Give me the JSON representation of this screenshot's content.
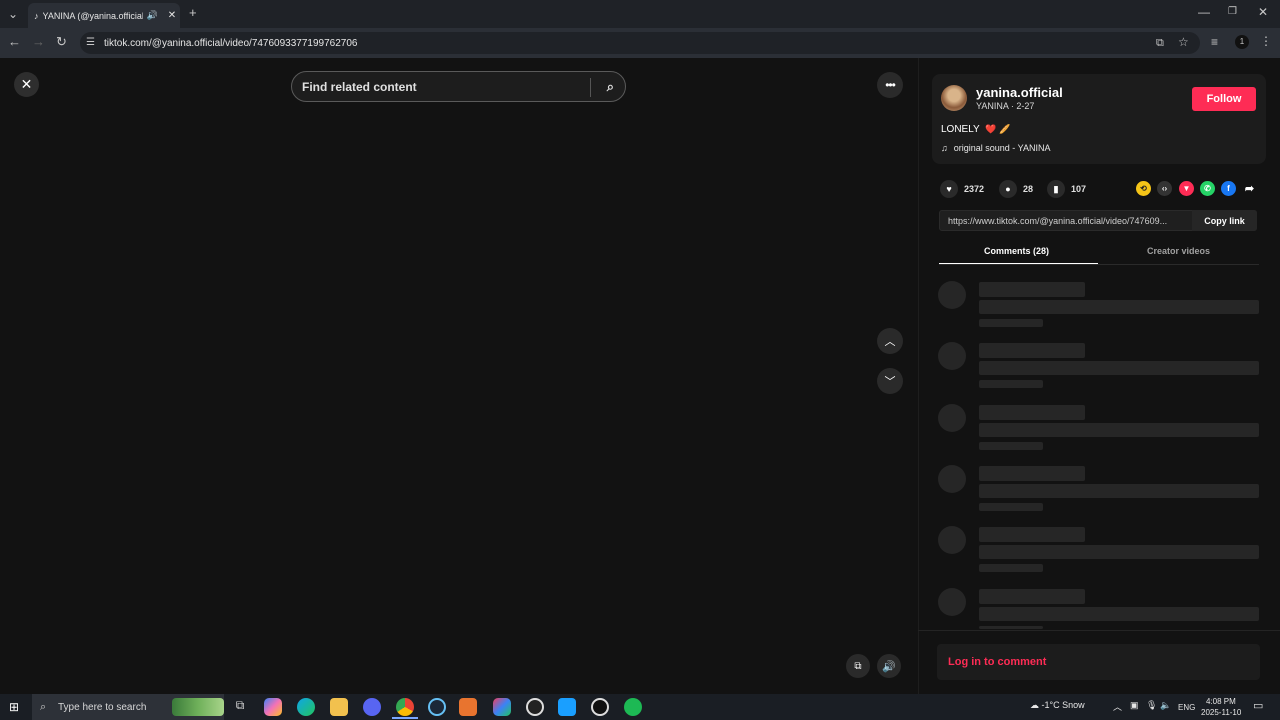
{
  "browser": {
    "tab_title": "YANINA (@yanina.official) |",
    "url": "tiktok.com/@yanina.official/video/7476093377199762706"
  },
  "video": {
    "search_placeholder": "Find related content"
  },
  "creator": {
    "username": "yanina.official",
    "display_name": "YANINA",
    "date": "2-27",
    "follow_label": "Follow",
    "caption": "LONELY",
    "caption_emoji": "❤️ 🥖",
    "sound": "original sound - YANINA"
  },
  "stats": {
    "likes": "2372",
    "comments": "28",
    "saves": "107"
  },
  "link": {
    "url": "https://www.tiktok.com/@yanina.official/video/747609...",
    "copy_label": "Copy link"
  },
  "tabs": {
    "comments_label": "Comments (28)",
    "creator_label": "Creator videos"
  },
  "login": {
    "label": "Log in to comment"
  },
  "taskbar": {
    "search_placeholder": "Type here to search",
    "weather": "-1°C  Snow",
    "language": "ENG",
    "time": "4:08 PM",
    "date": "2025-11-10"
  },
  "colors": {
    "accent": "#fe2c55",
    "background": "#121212"
  }
}
